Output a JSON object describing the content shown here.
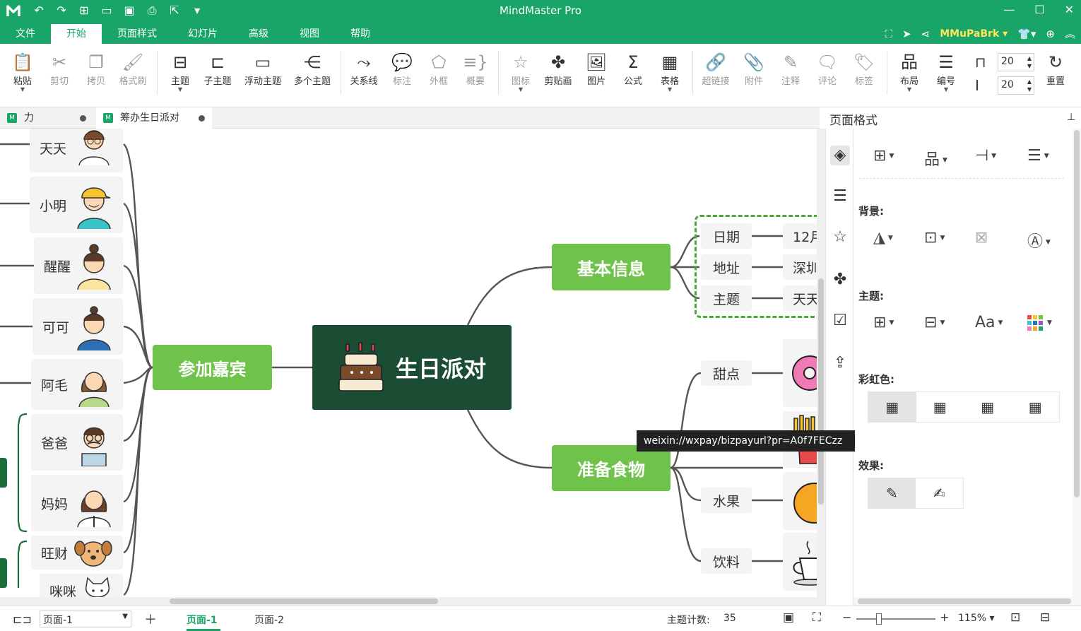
{
  "app": {
    "title": "MindMaster Pro",
    "user": "MMuPaBrk"
  },
  "menu": {
    "tabs": [
      "文件",
      "开始",
      "页面样式",
      "幻灯片",
      "高级",
      "视图",
      "帮助"
    ],
    "active": 1
  },
  "ribbon": {
    "paste": "粘贴",
    "cut": "剪切",
    "copy": "拷贝",
    "format_painter": "格式刷",
    "topic": "主题",
    "subtopic": "子主题",
    "floating_topic": "浮动主题",
    "multiple_topics": "多个主题",
    "relationship": "关系线",
    "callout": "标注",
    "boundary": "外框",
    "summary": "概要",
    "icon": "图标",
    "clipart": "剪贴画",
    "picture": "图片",
    "formula": "公式",
    "table": "表格",
    "hyperlink": "超链接",
    "attachment": "附件",
    "note": "注释",
    "comment": "评论",
    "tag": "标签",
    "layout": "布局",
    "numbering": "编号",
    "spacing_h": "20",
    "spacing_v": "20",
    "reset": "重置"
  },
  "doc_tabs": [
    {
      "label": "力"
    },
    {
      "label": "筹办生日派对"
    }
  ],
  "mindmap": {
    "root": "生日派对",
    "main": {
      "guests": "参加嘉宾",
      "info": "基本信息",
      "food": "准备食物"
    },
    "guests": [
      "天天",
      "小明",
      "醒醒",
      "可可",
      "阿毛",
      "爸爸",
      "妈妈",
      "旺财",
      "咪咪"
    ],
    "info_rows": [
      {
        "label": "日期",
        "value": "12月"
      },
      {
        "label": "地址",
        "value": "深圳"
      },
      {
        "label": "主题",
        "value": "天天"
      }
    ],
    "food_items": [
      "甜点",
      "水果",
      "饮料"
    ]
  },
  "tooltip": "weixin://wxpay/bizpayurl?pr=A0f7FECzz",
  "panel": {
    "title": "页面格式",
    "background_label": "背景:",
    "theme_label": "主题:",
    "rainbow_label": "彩虹色:",
    "effect_label": "效果:",
    "font_label": "Aa"
  },
  "status": {
    "page_select": "页面-1",
    "pages": [
      "页面-1",
      "页面-2"
    ],
    "topic_count_label": "主题计数:",
    "topic_count": "35",
    "zoom": "115%"
  },
  "colors": {
    "brand": "#1aa568",
    "root": "#1a4d33",
    "main": "#6fc34a"
  }
}
